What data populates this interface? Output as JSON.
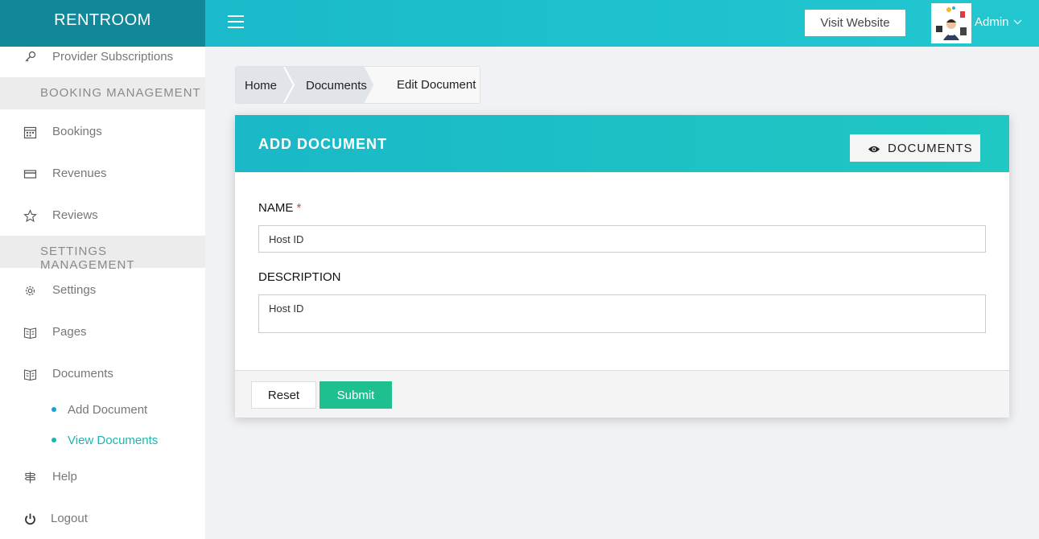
{
  "brand": "RENTROOM",
  "header": {
    "visit_website": "Visit Website",
    "user_name": "Admin",
    "icons": {
      "menu": "hamburger-icon",
      "caret": "chevron-down-icon"
    }
  },
  "sidebar": {
    "items": [
      {
        "label": "Provider Subscriptions",
        "icon": "key-icon"
      },
      {
        "label": "Bookings",
        "icon": "calendar-icon"
      },
      {
        "label": "Revenues",
        "icon": "credit-card-icon"
      },
      {
        "label": "Reviews",
        "icon": "star-icon"
      },
      {
        "label": "Settings",
        "icon": "gear-icon"
      },
      {
        "label": "Pages",
        "icon": "book-icon"
      },
      {
        "label": "Documents",
        "icon": "book-icon"
      },
      {
        "label": "Help",
        "icon": "signpost-icon"
      },
      {
        "label": "Logout",
        "icon": "power-icon"
      }
    ],
    "headers": [
      "BOOKING MANAGEMENT",
      "SETTINGS MANAGEMENT"
    ],
    "subitems": [
      {
        "label": "Add Document",
        "color": "#1a9fd9"
      },
      {
        "label": "View Documents",
        "color": "#1ab7b0"
      }
    ]
  },
  "breadcrumb": [
    "Home",
    "Documents",
    "Edit Document"
  ],
  "card": {
    "title": "ADD DOCUMENT",
    "documents_button": "DOCUMENTS",
    "name_label": "NAME",
    "required_mark": "*",
    "name_value": "Host ID",
    "description_label": "DESCRIPTION",
    "description_value": "Host ID",
    "reset": "Reset",
    "submit": "Submit"
  },
  "colors": {
    "accent": "#1ab8c8",
    "brand_bg": "#11879a",
    "submit": "#1ec08f"
  }
}
